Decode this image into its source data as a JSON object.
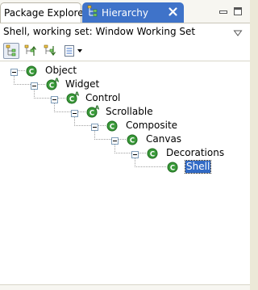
{
  "tabs": [
    {
      "label": "Package Explorer",
      "active": false
    },
    {
      "label": "Hierarchy",
      "active": true,
      "icon": "type-hierarchy-icon"
    }
  ],
  "view_controls": {
    "minimize": "minimize-icon",
    "maximize": "maximize-icon"
  },
  "title_line": {
    "text": "Shell, working set: Window Working Set",
    "menu_icon": "view-menu-icon"
  },
  "toolbar": [
    {
      "icon": "show-type-hierarchy-icon",
      "pressed": true
    },
    {
      "icon": "show-supertype-hierarchy-icon",
      "pressed": false
    },
    {
      "icon": "show-subtype-hierarchy-icon",
      "pressed": false
    },
    {
      "icon": "layout-icon",
      "pressed": false
    },
    {
      "icon": "layout-menu-icon",
      "pressed": false
    }
  ],
  "tree": {
    "nodes": [
      {
        "label": "Object",
        "depth": 0,
        "abstract": false,
        "expanded": true,
        "selected": false
      },
      {
        "label": "Widget",
        "depth": 1,
        "abstract": true,
        "expanded": true,
        "selected": false
      },
      {
        "label": "Control",
        "depth": 2,
        "abstract": true,
        "expanded": true,
        "selected": false
      },
      {
        "label": "Scrollable",
        "depth": 3,
        "abstract": true,
        "expanded": true,
        "selected": false
      },
      {
        "label": "Composite",
        "depth": 4,
        "abstract": false,
        "expanded": true,
        "selected": false
      },
      {
        "label": "Canvas",
        "depth": 5,
        "abstract": false,
        "expanded": true,
        "selected": false
      },
      {
        "label": "Decorations",
        "depth": 6,
        "abstract": false,
        "expanded": true,
        "selected": false
      },
      {
        "label": "Shell",
        "depth": 7,
        "abstract": false,
        "expanded": false,
        "selected": true
      }
    ]
  },
  "colors": {
    "active_tab": "#3f73c9",
    "class_icon": "#3a9a3a",
    "selection": "#316ac5"
  }
}
